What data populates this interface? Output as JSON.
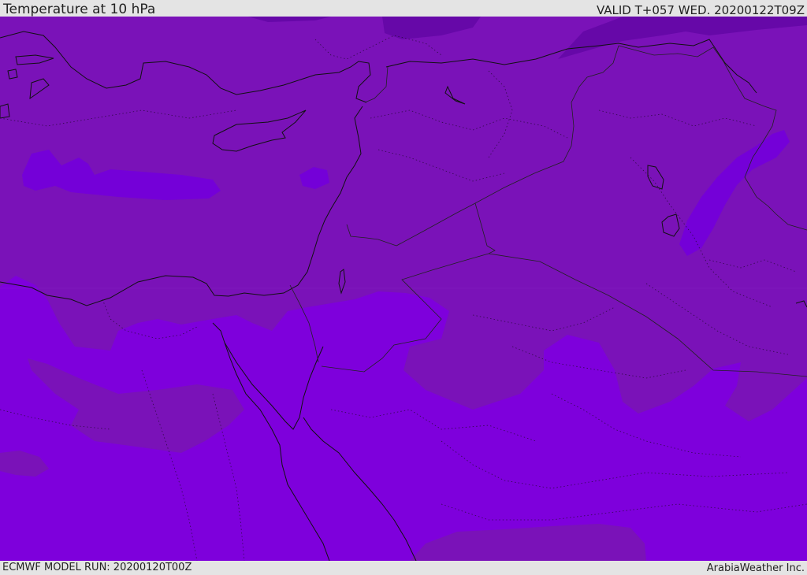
{
  "header": {
    "title": "Temperature at 10 hPa",
    "valid_time": "VALID T+057 WED. 20200122T09Z"
  },
  "footer": {
    "model_run": "ECMWF MODEL RUN: 20200120T00Z",
    "brand": "ArabiaWeather Inc."
  },
  "map": {
    "region": "Eastern Mediterranean and Middle East",
    "colors": {
      "warm_field": "#7a12b8",
      "cold_field": "#7e00dc",
      "coldest_patch": "#7400d8",
      "darker_patch": "#6608a8",
      "coastline": "#111111",
      "border": "#222222"
    }
  }
}
